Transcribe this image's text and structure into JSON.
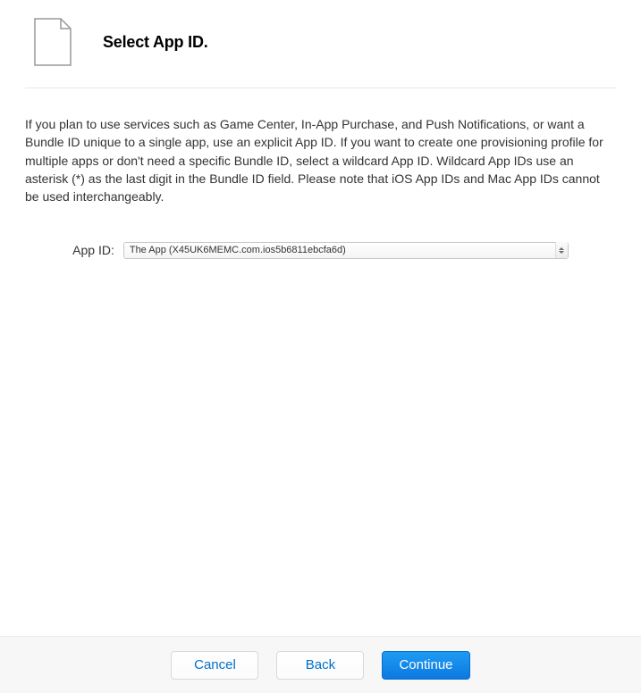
{
  "header": {
    "title": "Select App ID."
  },
  "description": "If you plan to use services such as Game Center, In-App Purchase, and Push Notifications, or want a Bundle ID unique to a single app, use an explicit App ID. If you want to create one provisioning profile for multiple apps or don't need a specific Bundle ID, select a wildcard App ID. Wildcard App IDs use an asterisk (*) as the last digit in the Bundle ID field. Please note that iOS App IDs and Mac App IDs cannot be used interchangeably.",
  "form": {
    "app_id_label": "App ID:",
    "app_id_selected": "The App (X45UK6MEMC.com.ios5b6811ebcfa6d)"
  },
  "footer": {
    "cancel": "Cancel",
    "back": "Back",
    "continue": "Continue"
  }
}
